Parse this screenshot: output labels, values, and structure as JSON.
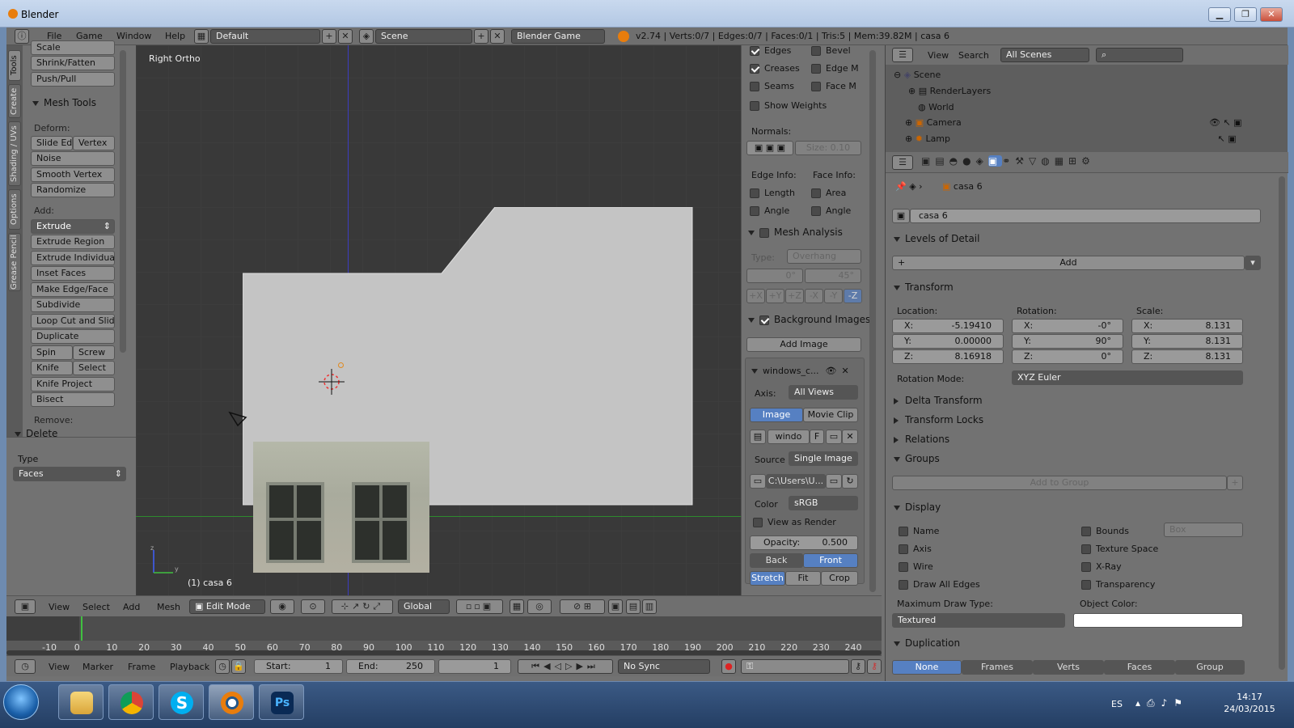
{
  "window": {
    "title": "Blender"
  },
  "header": {
    "menus": [
      "File",
      "Game",
      "Window",
      "Help"
    ],
    "layout": "Default",
    "scene": "Scene",
    "engine": "Blender Game",
    "info": "v2.74 | Verts:0/7 | Edges:0/7 | Faces:0/1 | Tris:5 | Mem:39.82M | casa 6"
  },
  "vtabs": [
    "Tools",
    "Create",
    "Shading / UVs",
    "Options",
    "Grease Pencil"
  ],
  "toolshelf": {
    "top_buttons": [
      "Scale",
      "Shrink/Fatten",
      "Push/Pull"
    ],
    "mesh_tools": "Mesh Tools",
    "deform": "Deform:",
    "deform_pair": [
      "Slide Ed",
      "Vertex"
    ],
    "deform_buttons": [
      "Noise",
      "Smooth Vertex",
      "Randomize"
    ],
    "add": "Add:",
    "extrude": "Extrude",
    "add_buttons": [
      "Extrude Region",
      "Extrude Individual",
      "Inset Faces",
      "Make Edge/Face",
      "Subdivide",
      "Loop Cut and Slide",
      "Duplicate"
    ],
    "pair1": [
      "Spin",
      "Screw"
    ],
    "pair2": [
      "Knife",
      "Select"
    ],
    "more_buttons": [
      "Knife Project",
      "Bisect"
    ],
    "remove": "Remove:"
  },
  "operator": {
    "title": "Delete",
    "type_label": "Type",
    "type_value": "Faces"
  },
  "viewport": {
    "view_name": "Right Ortho",
    "object_label": "(1) casa 6"
  },
  "vprops": {
    "overlay": [
      {
        "l": "Edges",
        "on": true,
        "r": "Bevel"
      },
      {
        "l": "Creases",
        "on": true,
        "r": "Edge M"
      },
      {
        "l": "Seams",
        "on": false,
        "r": "Face M"
      }
    ],
    "show_weights": "Show Weights",
    "normals": "Normals:",
    "size": "Size: 0.10",
    "edge_info": "Edge Info:",
    "face_info": "Face Info:",
    "length": "Length",
    "area": "Area",
    "angle1": "Angle",
    "angle2": "Angle",
    "mesh_analysis": "Mesh Analysis",
    "type_label": "Type:",
    "type_value": "Overhang",
    "deg_min": "0°",
    "deg_max": "45°",
    "axes": [
      "+X",
      "+Y",
      "+Z",
      "-X",
      "-Y",
      "-Z"
    ],
    "bg_images": "Background Images",
    "add_image": "Add Image",
    "img_name": "windows_c...",
    "axis_label": "Axis:",
    "axis_value": "All Views",
    "image_tab": "Image",
    "movie_tab": "Movie Clip",
    "img_field": "windo",
    "f": "F",
    "source_label": "Source",
    "source_value": "Single Image",
    "path": "C:\\Users\\U...",
    "color_label": "Color",
    "color_value": "sRGB",
    "view_render": "View as Render",
    "opacity_label": "Opacity:",
    "opacity_value": "0.500",
    "back": "Back",
    "front": "Front",
    "stretch": "Stretch",
    "fit": "Fit",
    "crop": "Crop"
  },
  "outliner": {
    "menus": [
      "View",
      "Search"
    ],
    "filter": "All Scenes",
    "rows": [
      "Scene",
      "RenderLayers",
      "World",
      "Camera",
      "Lamp"
    ]
  },
  "props": {
    "breadcrumb": "casa 6",
    "name": "casa 6",
    "lod": "Levels of Detail",
    "add": "Add",
    "transform": "Transform",
    "location": "Location:",
    "rotation": "Rotation:",
    "scale": "Scale:",
    "loc": [
      {
        "k": "X:",
        "v": "-5.19410"
      },
      {
        "k": "Y:",
        "v": "0.00000"
      },
      {
        "k": "Z:",
        "v": "8.16918"
      }
    ],
    "rot": [
      {
        "k": "X:",
        "v": "-0°"
      },
      {
        "k": "Y:",
        "v": "90°"
      },
      {
        "k": "Z:",
        "v": "0°"
      }
    ],
    "scl": [
      {
        "k": "X:",
        "v": "8.131"
      },
      {
        "k": "Y:",
        "v": "8.131"
      },
      {
        "k": "Z:",
        "v": "8.131"
      }
    ],
    "rot_mode_label": "Rotation Mode:",
    "rot_mode": "XYZ Euler",
    "collapsed": [
      "Delta Transform",
      "Transform Locks",
      "Relations"
    ],
    "groups": "Groups",
    "add_group": "Add to Group",
    "display": "Display",
    "disp_left": [
      "Name",
      "Axis",
      "Wire",
      "Draw All Edges"
    ],
    "disp_right": [
      "Bounds",
      "Texture Space",
      "X-Ray",
      "Transparency"
    ],
    "bounds_value": "Box",
    "max_draw_label": "Maximum Draw Type:",
    "max_draw": "Textured",
    "obj_color_label": "Object Color:",
    "duplication": "Duplication",
    "dup": [
      "None",
      "Frames",
      "Verts",
      "Faces",
      "Group"
    ]
  },
  "vpheader": {
    "menus": [
      "View",
      "Select",
      "Add",
      "Mesh"
    ],
    "mode": "Edit Mode",
    "orientation": "Global"
  },
  "timeline": {
    "ticks": [
      "-10",
      "0",
      "10",
      "20",
      "30",
      "40",
      "50",
      "60",
      "70",
      "80",
      "90",
      "100",
      "110",
      "120",
      "130",
      "140",
      "150",
      "160",
      "170",
      "180",
      "190",
      "200",
      "210",
      "220",
      "230",
      "240"
    ]
  },
  "tlheader": {
    "menus": [
      "View",
      "Marker",
      "Frame",
      "Playback"
    ],
    "start_label": "Start:",
    "start": "1",
    "end_label": "End:",
    "end": "250",
    "current": "1",
    "sync": "No Sync"
  },
  "taskbar": {
    "lang": "ES",
    "time": "14:17",
    "date": "24/03/2015"
  },
  "colors": {
    "accent": "#5680c2",
    "viewport": "#393939",
    "panel": "#727272",
    "mesh": "#c4c4c4"
  }
}
